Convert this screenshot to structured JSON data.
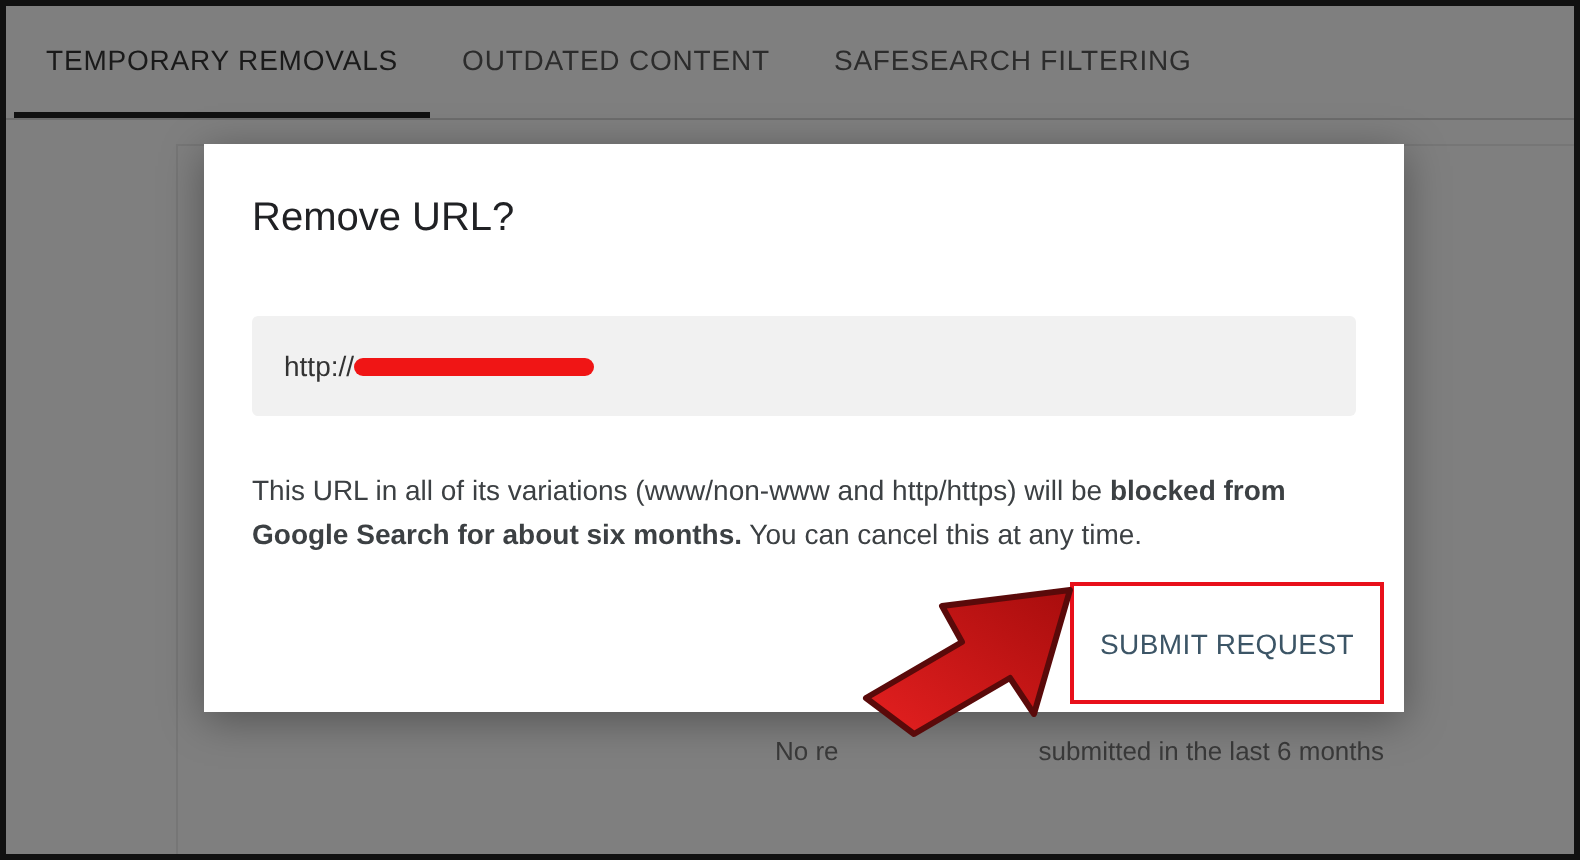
{
  "tabs": [
    {
      "label": "TEMPORARY REMOVALS",
      "selected": true
    },
    {
      "label": "OUTDATED CONTENT",
      "selected": false
    },
    {
      "label": "SAFESEARCH FILTERING",
      "selected": false
    }
  ],
  "background_message": [
    "No re",
    "submitted in the last 6 months"
  ],
  "dialog": {
    "title": "Remove URL?",
    "url_field": {
      "value": "http://",
      "redacted": true
    },
    "body": "This URL in all of its variations (www/non-www and http/https) will be **blocked from Google Search for about six months.** You can cancel this at any time.",
    "button": "SUBMIT REQUEST",
    "button_highlighted": true
  }
}
